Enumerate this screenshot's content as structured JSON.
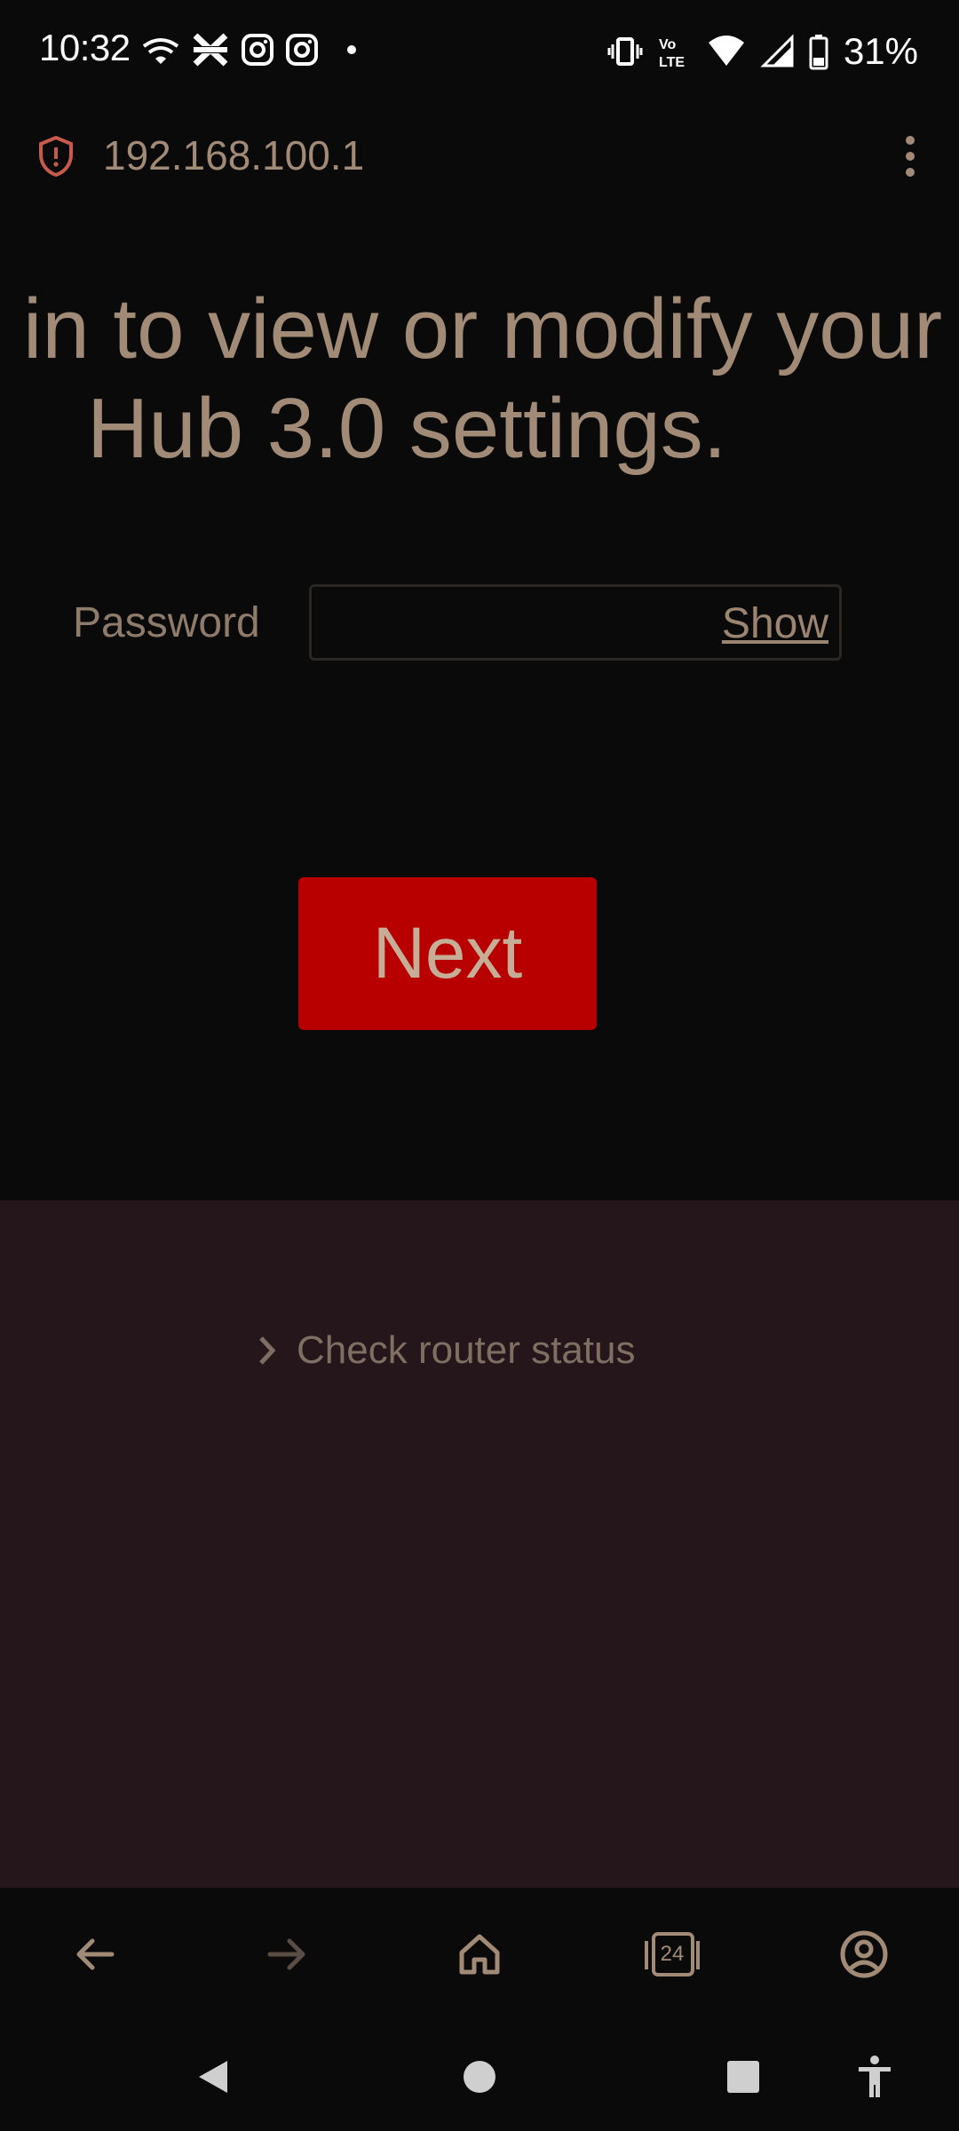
{
  "status_bar": {
    "time": "10:32",
    "battery_percent": "31%",
    "left_icons": [
      "wifi-calling-icon",
      "halifax-app-icon",
      "instagram-icon",
      "instagram-icon",
      "notification-dot-icon"
    ],
    "right_icons": [
      "vibrate-icon",
      "volte-icon",
      "wifi-icon",
      "signal-icon",
      "battery-icon"
    ],
    "volte_label_top": "Vo",
    "volte_label_bottom": "LTE"
  },
  "url_bar": {
    "url": "192.168.100.1",
    "security_icon": "shield-alert-icon",
    "menu_icon": "more-vert-icon"
  },
  "headline": {
    "line1": "in to view or modify your",
    "line2": "Hub 3.0 settings."
  },
  "login_form": {
    "password_label": "Password",
    "password_value": "",
    "show_label": "Show",
    "next_label": "Next"
  },
  "footer_section": {
    "router_status_label": "Check router status"
  },
  "browser_toolbar": {
    "tab_count": "24",
    "icons": [
      "back-arrow-icon",
      "forward-arrow-icon",
      "home-icon",
      "tabs-icon",
      "account-icon"
    ]
  },
  "nav_bar": {
    "icons": [
      "nav-back-icon",
      "nav-home-icon",
      "nav-recents-icon",
      "accessibility-icon"
    ]
  },
  "colors": {
    "background": "#0b0a0a",
    "text_accent": "#a28b76",
    "button_red": "#b80000",
    "lower_section": "#24161a"
  }
}
